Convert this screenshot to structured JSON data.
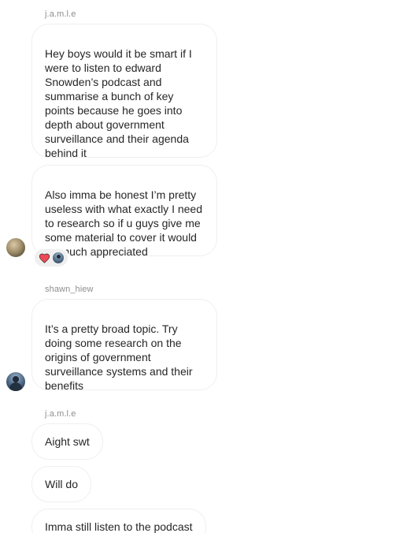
{
  "messages": [
    {
      "sender": "j.a.m.l.e",
      "text": "Hey boys would it be smart if I were to listen to edward Snowden’s podcast and summarise a bunch of key points because he goes into depth about government surveillance and their agenda behind it"
    },
    {
      "text": "Also imma be honest I’m pretty useless with what exactly I need to research so if u guys give me some material to cover it would be much appreciated",
      "reactions": [
        "heart-reaction",
        "reactor-avatar"
      ]
    },
    {
      "sender": "shawn_hiew",
      "text": "It’s a pretty broad topic. Try doing some research on the origins of government surveillance systems and their benefits"
    },
    {
      "sender": "j.a.m.l.e",
      "text": "Aight swt"
    },
    {
      "text": "Will do"
    },
    {
      "text": "Imma still listen to the podcast"
    }
  ],
  "colors": {
    "bubble_border": "#efefef",
    "sender_text": "#8e8e8e",
    "message_text": "#262626",
    "heart": "#ed4956",
    "reaction_pill": "#efefef"
  }
}
